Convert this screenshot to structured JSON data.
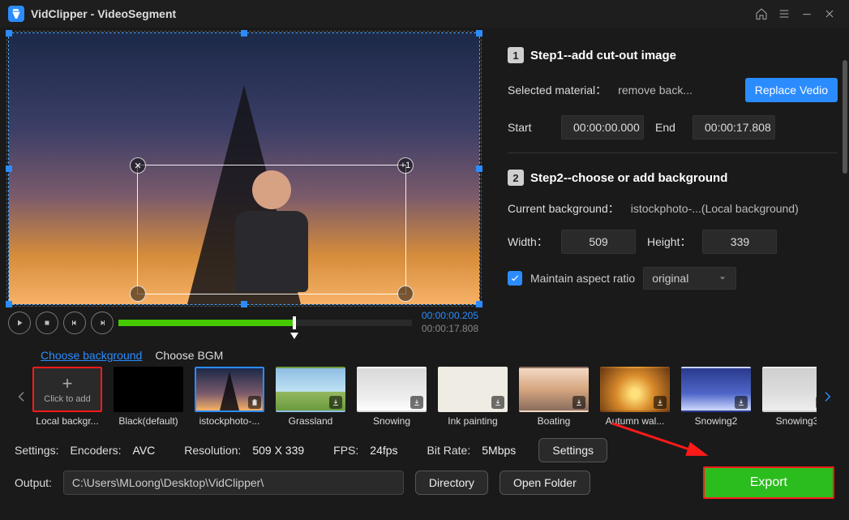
{
  "app": {
    "title": "VidClipper  -  VideoSegment"
  },
  "player": {
    "current_time": "00:00:00.205",
    "duration": "00:00:17.808"
  },
  "step1": {
    "title": "Step1--add cut-out image",
    "selected_label": "Selected material：",
    "selected_value": "remove back...",
    "replace_btn": "Replace Vedio",
    "start_label": "Start",
    "start_value": "00:00:00.000",
    "end_label": "End",
    "end_value": "00:00:17.808"
  },
  "step2": {
    "title": "Step2--choose or add background",
    "current_bg_label": "Current background：",
    "current_bg_value": "istockphoto-...(Local background)",
    "width_label": "Width：",
    "width_value": "509",
    "height_label": "Height：",
    "height_value": "339",
    "aspect_label": "Maintain aspect ratio",
    "aspect_select": "original"
  },
  "bg_tabs": {
    "choose_bg": "Choose background",
    "choose_bgm": "Choose BGM"
  },
  "thumbs": [
    {
      "add_label": "Click to add",
      "caption": "Local backgr..."
    },
    {
      "caption": "Black(default)"
    },
    {
      "caption": "istockphoto-..."
    },
    {
      "caption": "Grassland"
    },
    {
      "caption": "Snowing"
    },
    {
      "caption": "Ink painting"
    },
    {
      "caption": "Boating"
    },
    {
      "caption": "Autumn wal..."
    },
    {
      "caption": "Snowing2"
    },
    {
      "caption": "Snowing3"
    }
  ],
  "settings": {
    "settings_label": "Settings:",
    "encoders_label": "Encoders:",
    "encoders_value": "AVC",
    "resolution_label": "Resolution:",
    "resolution_value": "509 X 339",
    "fps_label": "FPS:",
    "fps_value": "24fps",
    "bitrate_label": "Bit Rate:",
    "bitrate_value": "5Mbps",
    "settings_btn": "Settings",
    "output_label": "Output:",
    "output_path": "C:\\Users\\MLoong\\Desktop\\VidClipper\\",
    "directory_btn": "Directory",
    "open_folder_btn": "Open Folder",
    "export_btn": "Export"
  }
}
